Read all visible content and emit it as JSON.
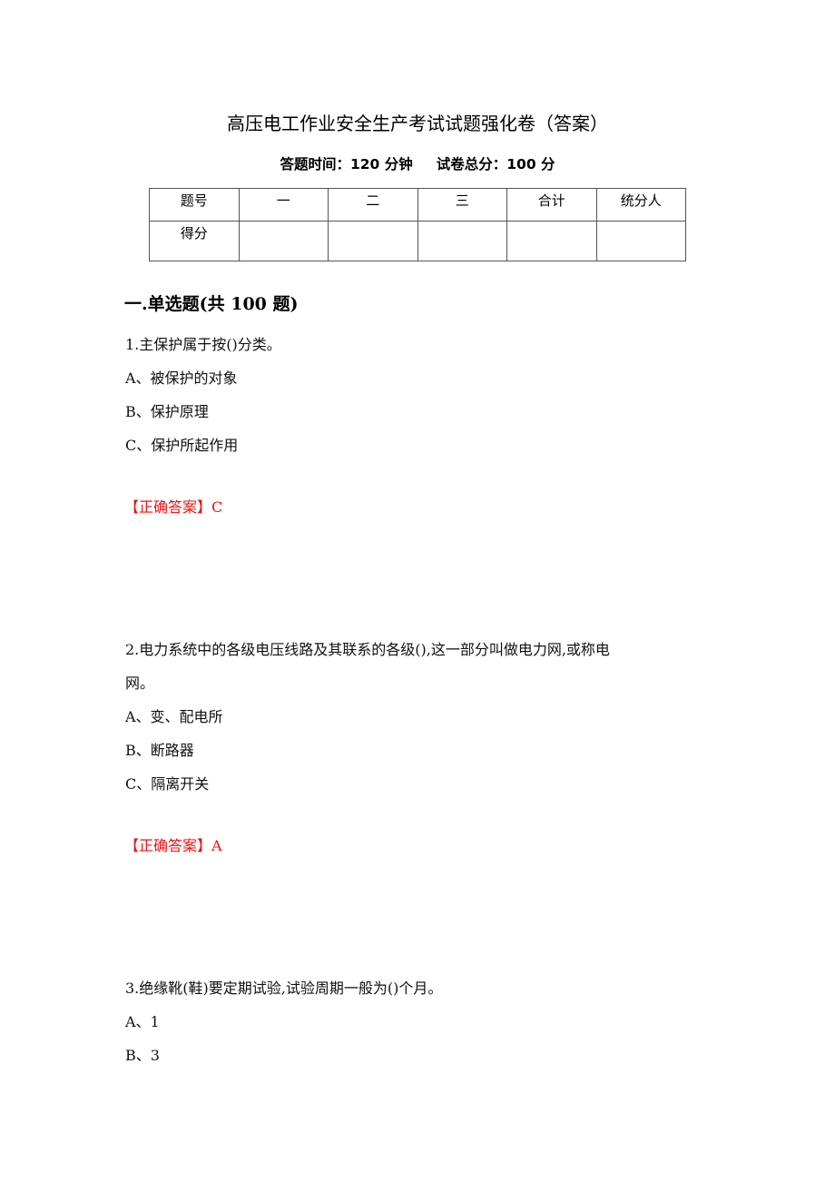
{
  "document": {
    "title": "高压电工作业安全生产考试试题强化卷（答案）",
    "exam_time_label": "答题时间：120 分钟",
    "total_score_label": "试卷总分：100 分"
  },
  "score_table": {
    "header": [
      "题号",
      "一",
      "二",
      "三",
      "合计",
      "统分人"
    ],
    "row2_label": "得分",
    "row2_values": [
      "",
      "",
      "",
      "",
      ""
    ]
  },
  "section": {
    "heading": "一.单选题(共 100 题)"
  },
  "questions": [
    {
      "stem": "1.主保护属于按()分类。",
      "options": [
        "A、被保护的对象",
        "B、保护原理",
        "C、保护所起作用"
      ],
      "answer_label": "【正确答案】C"
    },
    {
      "stem_line1": "2.电力系统中的各级电压线路及其联系的各级(),这一部分叫做电力网,或称电",
      "stem_line2": "网。",
      "options": [
        "A、变、配电所",
        "B、断路器",
        "C、隔离开关"
      ],
      "answer_label": "【正确答案】A"
    },
    {
      "stem": "3.绝缘靴(鞋)要定期试验,试验周期一般为()个月。",
      "options": [
        "A、1",
        "B、3"
      ]
    }
  ],
  "colors": {
    "answer": "#ee1111",
    "text": "#111111"
  }
}
